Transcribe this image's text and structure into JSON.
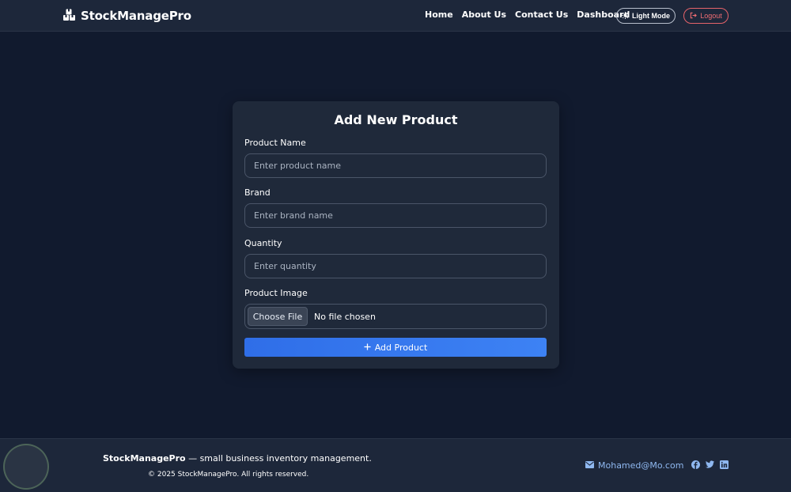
{
  "nav": {
    "brand": "StockManagePro",
    "links": [
      "Home",
      "About Us",
      "Contact Us",
      "Dashboard"
    ],
    "theme_toggle": "Light Mode",
    "logout": "Logout"
  },
  "form": {
    "title": "Add New Product",
    "fields": [
      {
        "label": "Product Name",
        "placeholder": "Enter product name",
        "value": ""
      },
      {
        "label": "Brand",
        "placeholder": "Enter brand name",
        "value": ""
      },
      {
        "label": "Quantity",
        "placeholder": "Enter quantity",
        "value": ""
      }
    ],
    "image": {
      "label": "Product Image",
      "button": "Choose File",
      "status": "No file chosen"
    },
    "submit": "Add Product"
  },
  "footer": {
    "brand": "StockManagePro",
    "tagline": " — small business inventory management.",
    "copyright": "© 2025 StockManagePro. All rights reserved.",
    "email": "Mohamed@Mo.com",
    "social": [
      "facebook-icon",
      "twitter-icon",
      "linkedin-icon"
    ]
  },
  "colors": {
    "background": "#111a2e",
    "surface": "#1f293a",
    "primary": "#2f6ee8",
    "danger": "#ef6d73",
    "link": "#8fb8f0"
  }
}
